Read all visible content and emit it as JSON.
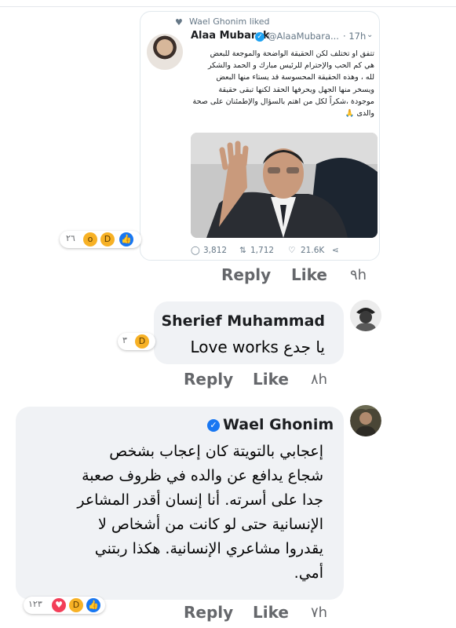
{
  "tweet": {
    "liked_by": "Wael Ghonim liked",
    "author_name": "Alaa Mubarak",
    "handle": "@AlaaMubara...",
    "time": "17h",
    "text_lines": [
      "تتفق او تختلف لكن الحقيقة الواضحة والموجعة للبعض",
      "هي كم الحب والإحترام للرئيس مبارك و الحمد والشكر",
      "لله ، وهذه الحقيقة المحسوسة قد يستاء منها البعض",
      "ويسخر منها الجهل ويحرفها الحقد لكنها تبقى حقيقة",
      "موجودة ،شكراً لكل من اهتم بالسؤال والإطمئنان على صحة",
      "والدى 🙏"
    ],
    "replies": "3,812",
    "retweets": "1,712",
    "likes": "21.6K",
    "post_reactions_count": "٢٦",
    "post_reply": "Reply",
    "post_like": "Like",
    "post_time": "٩h"
  },
  "comments": [
    {
      "name": "Sherief Muhammad",
      "text": "يا جدع Love works",
      "reactions_count": "٣",
      "reply": "Reply",
      "like": "Like",
      "time": "٨h"
    },
    {
      "name": "Wael Ghonim",
      "verified": true,
      "text_lines": [
        "إعجابي بالتويتة كان إعجاب بشخص",
        "شجاع يدافع عن والده في ظروف صعبة",
        "جدا على أسرته. أنا إنسان أقدر المشاعر",
        "الإنسانية حتى لو كانت من أشخاص لا",
        "يقدروا مشاعري الإنسانية. هكذا ربتني",
        "أمي."
      ],
      "reactions_count": "١٢٣",
      "reply": "Reply",
      "like": "Like",
      "time": "٧h"
    }
  ],
  "colors": {
    "bubble": "#f0f2f5",
    "muted": "#65676b",
    "twitter_blue": "#1da1f2",
    "fb_blue": "#1877f2"
  }
}
